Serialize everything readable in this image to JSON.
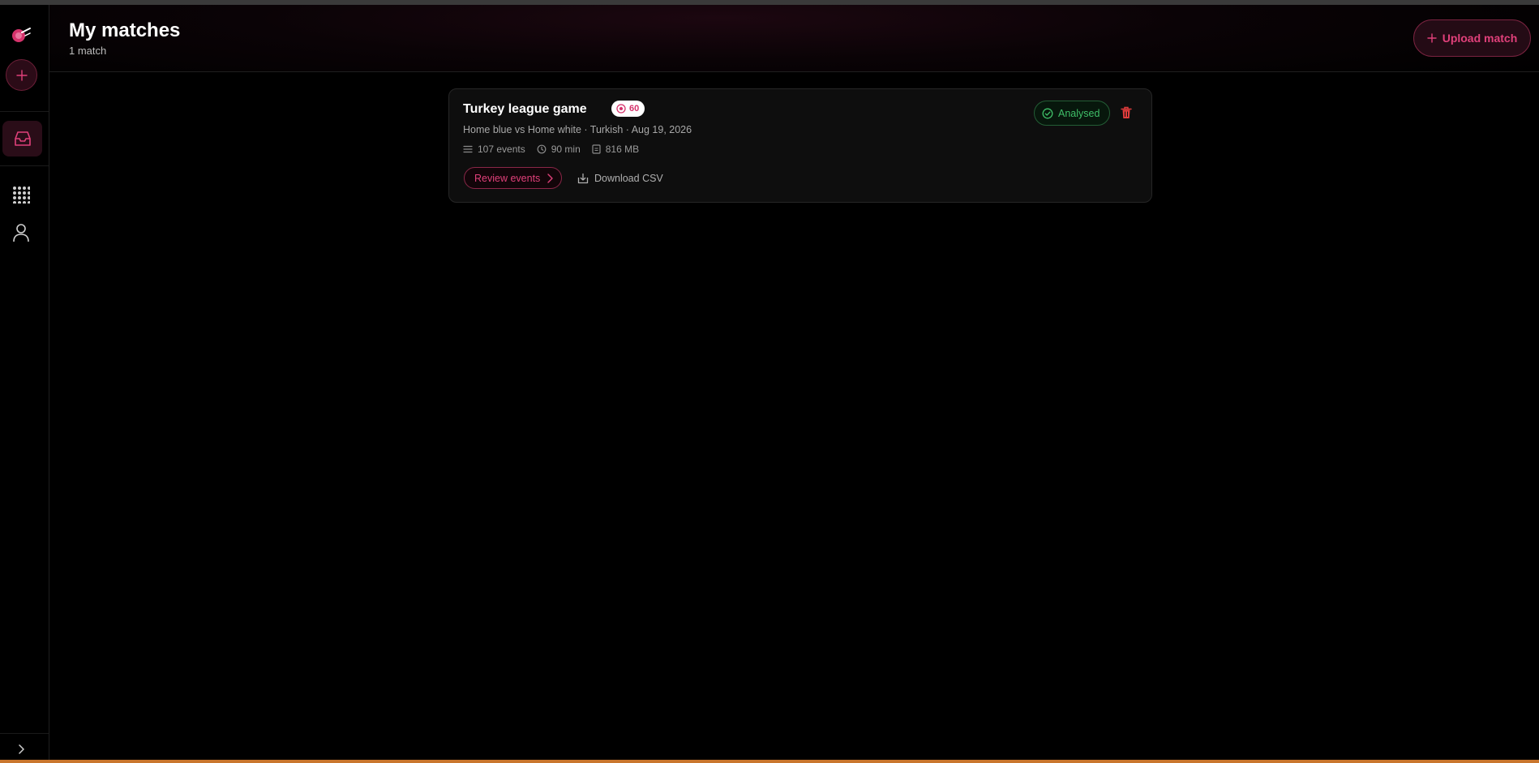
{
  "header": {
    "title": "My matches",
    "subtitle": "1 match",
    "upload_label": "Upload match"
  },
  "sidebar": {
    "items": [
      {
        "name": "logo",
        "icon": "logo-icon"
      },
      {
        "name": "new-match",
        "icon": "plus-icon"
      },
      {
        "name": "matches",
        "icon": "inbox-icon",
        "active": true
      },
      {
        "name": "apps",
        "icon": "grid-icon"
      },
      {
        "name": "profile",
        "icon": "user-icon"
      },
      {
        "name": "expand",
        "icon": "chevron-right-icon"
      }
    ]
  },
  "matches": [
    {
      "title": "Turkey league game",
      "score": "60",
      "meta": "Home blue vs Home white · Turkish · Aug 19, 2026",
      "events": "107 events",
      "duration": "90 min",
      "size": "816 MB",
      "status": "Analysed",
      "review_label": "Review events",
      "csv_label": "Download CSV"
    }
  ],
  "colors": {
    "accent": "#e0407a",
    "success": "#3fbf68",
    "danger": "#e03c3c",
    "background": "#000000",
    "bottom_bar": "#c9762d"
  }
}
